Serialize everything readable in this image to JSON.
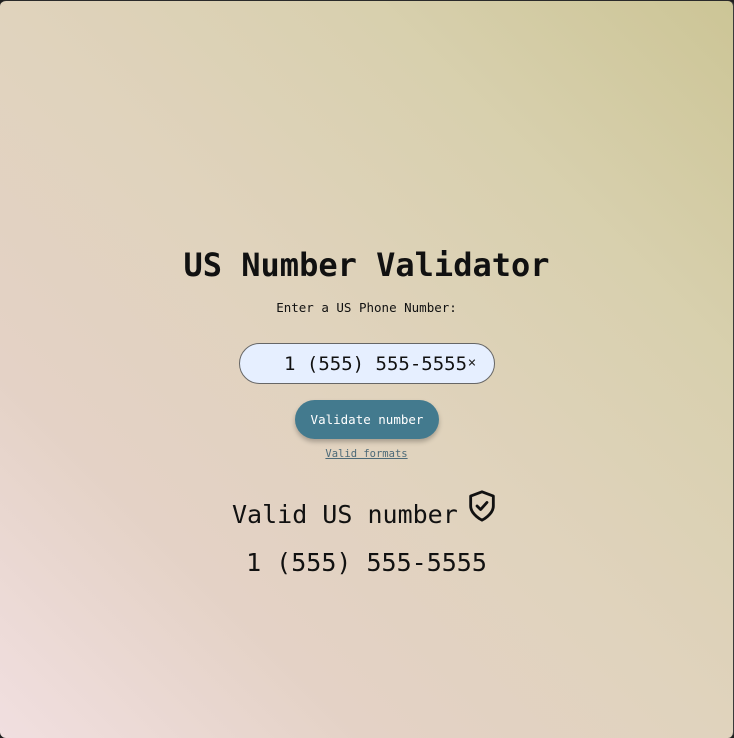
{
  "app": {
    "title": "US Number Validator",
    "input_label": "Enter a US Phone Number:"
  },
  "input": {
    "value": "1 (555) 555-5555",
    "placeholder": "",
    "clear_glyph": "×"
  },
  "buttons": {
    "validate_label": "Validate number"
  },
  "links": {
    "formats_label": "Valid formats"
  },
  "result": {
    "status_text": "Valid US number",
    "status_icon": "shield-check-icon",
    "number_text": "1 (555) 555-5555"
  },
  "colors": {
    "button_bg": "#437a8e",
    "input_bg": "#e6efff",
    "link": "#4d6a78"
  }
}
